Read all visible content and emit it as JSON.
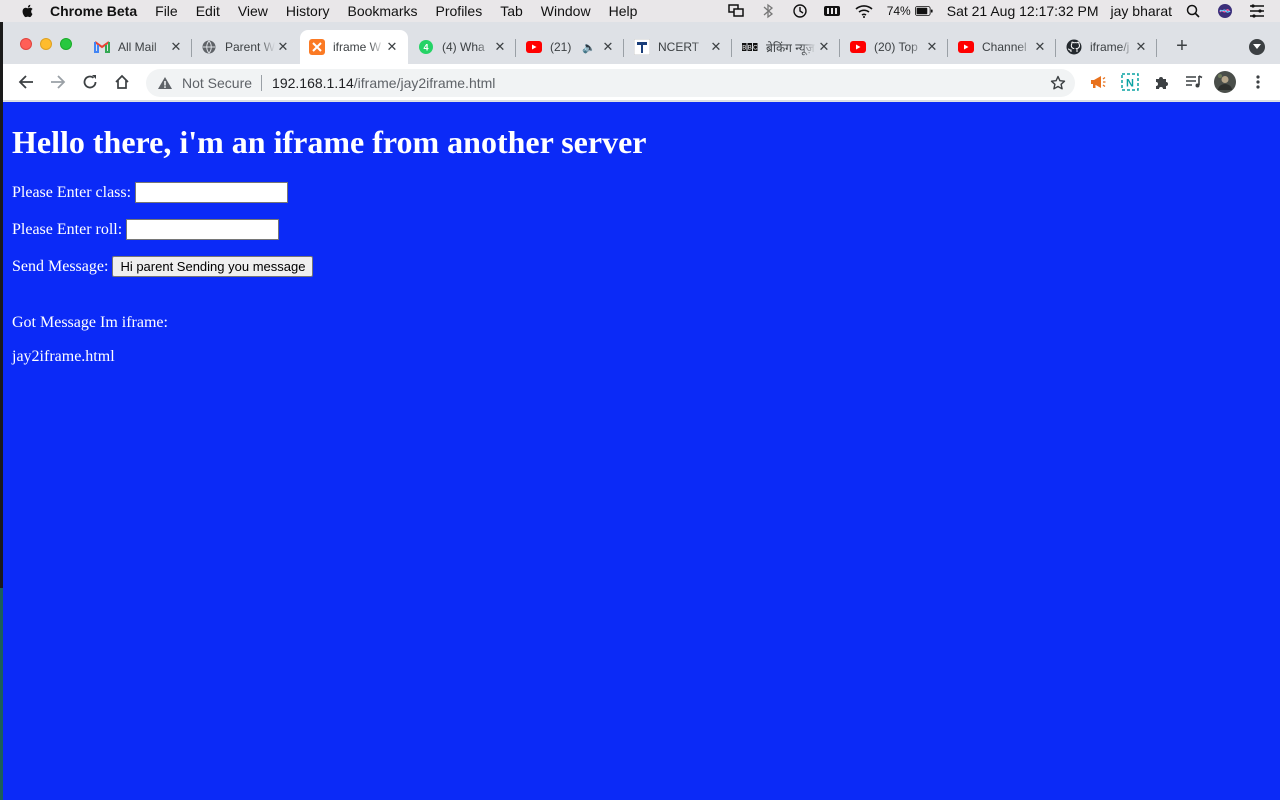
{
  "menubar": {
    "app_name": "Chrome Beta",
    "items": [
      "File",
      "Edit",
      "View",
      "History",
      "Bookmarks",
      "Profiles",
      "Tab",
      "Window",
      "Help"
    ],
    "battery": "74%",
    "datetime": "Sat 21 Aug  12:17:32 PM",
    "user": "jay bharat"
  },
  "tabs": [
    {
      "title": "All Mail",
      "icon": "gmail-icon",
      "active": false
    },
    {
      "title": "Parent W",
      "icon": "globe-icon",
      "active": false
    },
    {
      "title": "iframe W",
      "icon": "xampp-icon",
      "active": true
    },
    {
      "title": "(4) Wha",
      "icon": "whatsapp-icon",
      "active": false
    },
    {
      "title": "(21)",
      "icon": "youtube-icon",
      "active": false,
      "audio": true
    },
    {
      "title": "NCERT",
      "icon": "ncert-icon",
      "active": false
    },
    {
      "title": "ब्रेकिंग न्यूज़",
      "icon": "bbc-icon",
      "active": false
    },
    {
      "title": "(20) Top",
      "icon": "youtube-icon",
      "active": false
    },
    {
      "title": "Channel",
      "icon": "youtube-icon",
      "active": false
    },
    {
      "title": "iframe/j",
      "icon": "github-icon",
      "active": false
    }
  ],
  "omnibox": {
    "security_label": "Not Secure",
    "host": "192.168.1.14",
    "path": "/iframe/jay2iframe.html"
  },
  "page": {
    "heading": "Hello there, i'm an iframe from another server",
    "class_label": "Please Enter class:",
    "class_value": "",
    "roll_label": "Please Enter roll:",
    "roll_value": "",
    "send_label": "Send Message:",
    "send_button": "Hi parent Sending you message",
    "got_message_label": "Got Message Im iframe:",
    "filename": "jay2iframe.html"
  },
  "colors": {
    "page_background": "#0b2af7",
    "page_text": "#ffffff"
  }
}
